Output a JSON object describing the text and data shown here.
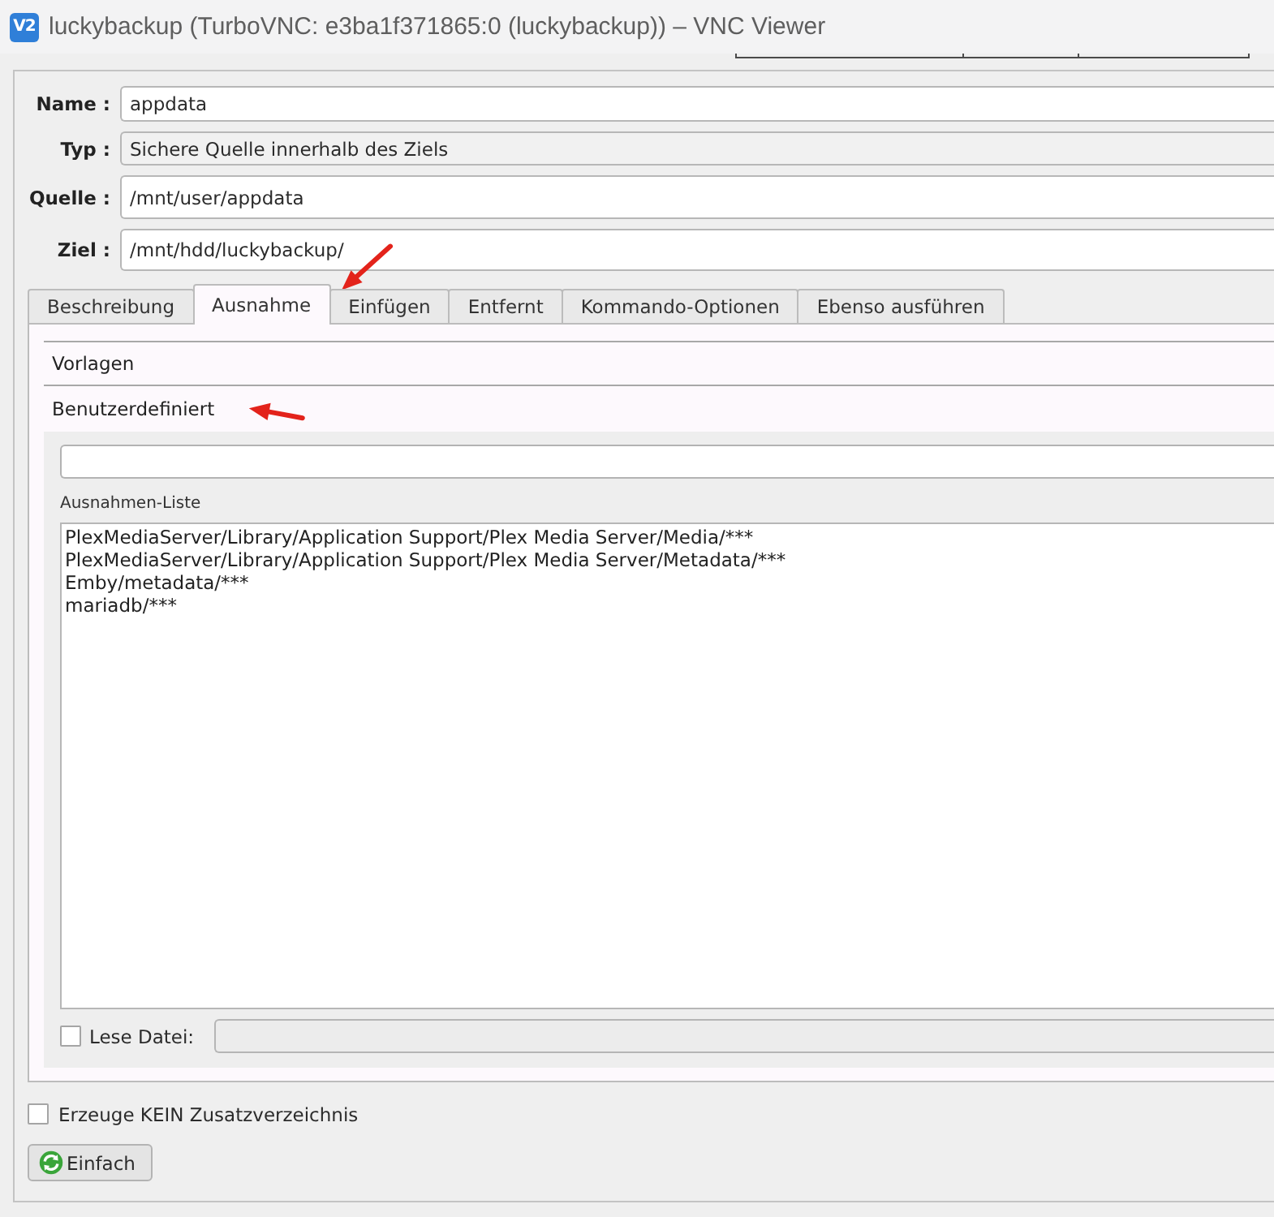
{
  "window": {
    "logo": "V2",
    "title": "luckybackup (TurboVNC: e3ba1f371865:0 (luckybackup)) – VNC Viewer"
  },
  "form": {
    "fields": [
      {
        "label": "Name :",
        "kind": "input",
        "value": "appdata"
      },
      {
        "label": "Typ :",
        "kind": "combo",
        "value": "Sichere Quelle innerhalb des Ziels"
      },
      {
        "label": "Quelle :",
        "kind": "input",
        "value": "/mnt/user/appdata"
      },
      {
        "label": "Ziel :",
        "kind": "input",
        "value": "/mnt/hdd/luckybackup/"
      }
    ]
  },
  "tabs": [
    {
      "label": "Beschreibung",
      "selected": false
    },
    {
      "label": "Ausnahme",
      "selected": true
    },
    {
      "label": "Einfügen",
      "selected": false
    },
    {
      "label": "Entfernt",
      "selected": false
    },
    {
      "label": "Kommando-Optionen",
      "selected": false
    },
    {
      "label": "Ebenso ausführen",
      "selected": false
    }
  ],
  "toolbox": {
    "sections": [
      {
        "label": "Vorlagen",
        "expanded": false
      },
      {
        "label": "Benutzerdefiniert",
        "expanded": true
      }
    ]
  },
  "exclusions": {
    "list_label": "Ausnahmen-Liste",
    "items": [
      {
        "text": "PlexMediaServer/Library/Application Support/Plex Media Server/Media/***",
        "selected": false
      },
      {
        "text": "PlexMediaServer/Library/Application Support/Plex Media Server/Metadata/***",
        "selected": false
      },
      {
        "text": "Emby/metadata/***",
        "selected": false
      },
      {
        "text": "mariadb/***",
        "selected": false
      }
    ],
    "read_file": {
      "label": "Lese Datei:",
      "checked": false,
      "field_disabled": true
    }
  },
  "options": [
    {
      "label": "Erzeuge KEIN Zusatzverzeichnis",
      "checked": false
    }
  ],
  "buttons": [
    {
      "label": "Einfach"
    }
  ]
}
